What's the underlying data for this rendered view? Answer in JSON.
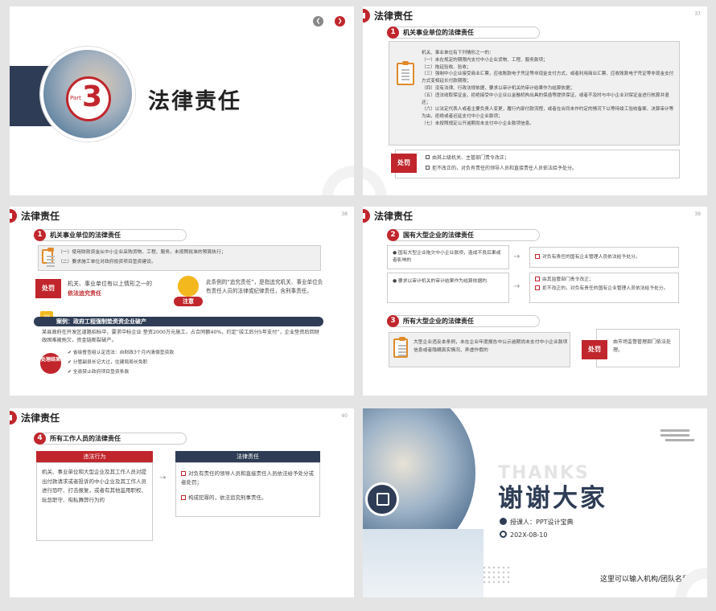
{
  "s1": {
    "part_word": "Part",
    "part_num": "3",
    "title": "法律责任",
    "nav_prev": "❮",
    "nav_next": "❯"
  },
  "s2": {
    "header": "法律责任",
    "page": "37",
    "sec_num": "1",
    "sec_label": "机关事业单位的法律责任",
    "lines": [
      "机关、事业单位有下列情形之一的：",
      "（一）未在规定的期限内支付中小企业货物、工程、服务款项；",
      "（二）拖延验收、验收；",
      "（三）强制中小企业接受商业汇票，应收账款电子凭证等非现金支付方式，或者利用商业汇票、应收账款电子凭证等非现金支付方式变相延长付款期限；",
      "（四）没有法律、行政法规依据，要求以审计机关的审计结果作为结算依据；",
      "（五）违法收取保证金，拒绝接受中小企业以金融机构出具的保函等提供保证，或者不及时与中小企业对保证金进行核算并退还；",
      "（六）以法定代表人或者主要负责人变更，履行内部付款流程，或者在合同未作约定的情况下以等待竣工验收备案、决算审计等为由，拒绝或者迟延支付中小企业款项；",
      "（七）未按照规定公开逾期尚未支付中小企业款项信息。"
    ],
    "tag": "处罚",
    "p1": "由其上级机关、主管部门责令改正；",
    "p2": "拒不改正的，对负有责任的领导人员和直接责任人员依法给予处分。"
  },
  "s3": {
    "header": "法律责任",
    "page": "38",
    "sec_num": "1",
    "sec_label": "机关事业单位的法律责任",
    "l1": "（一）使用财政资金从中小企业采购货物、工程、服务，未按照批准的预算执行；",
    "l2": "（二）要求施工单位对政府投资项目垫资建设。",
    "tag": "处罚",
    "pen_a": "机关、事业单位有以上情形之一的",
    "pen_b": "依法追究责任",
    "note": "注意",
    "note_text": "此条例的“追究责任”，是指追究机关、事业单位负有责任人员的法律或纪律责任，含刑事责任。",
    "case_badge": "案例",
    "case_title": "案例：政府工程强制垫资资企业破产",
    "case_text": "某县政府在开发区道路招标中，要求中标企业 垫资2000万元施工，占合同额40%，约定“竣工后分5年支付”，企业垫资后回财政困难被拖欠，资金链断裂破产。",
    "result": "处理结果",
    "r1": "省级督查组认定违法：自财政3个月内清偿垫资款",
    "r2": "分管副县长记大过，住建局局长免职",
    "r3": "全县禁止政府项目垫资条款"
  },
  "s4": {
    "header": "法律责任",
    "page": "39",
    "sec2_num": "2",
    "sec2_label": "国有大型企业的法律责任",
    "q1": "国有大型企业拖欠中小企业款项，造成不良后果或者影响的",
    "a1": "对负有责任的国有企业管理人员依法给予处分。",
    "q2": "要求以审计机关的审计结果作为结算依据的",
    "a2a": "由其监管部门责令改正；",
    "a2b": "拒不改正的，对负有责任的国有企业管理人员依法给予处分。",
    "sec3_num": "3",
    "sec3_label": "所有大型企业的法律责任",
    "q3": "大型企业违反本条例，未在企业年度报告中公示逾期尚未支付中小企业款项信息或者隐瞒真实情况、弄虚作假的",
    "tag": "处罚",
    "a3": "由市场监督管理部门依法处理。"
  },
  "s5": {
    "header": "法律责任",
    "page": "40",
    "sec_num": "4",
    "sec_label": "所有工作人员的法律责任",
    "h1": "违法行为",
    "h2": "法律责任",
    "left": "机关、事业单位和大型企业及其工作人员对提出付款请求或者投诉的中小企业及其工作人员进行恐吓、打击报复，或者有其他滥用职权、玩忽职守、徇私舞弊行为的",
    "r1": "对负有责任的领导人员和直接责任人员依法给予处分或者处罚；",
    "r2": "构成犯罪的，依法追究刑事责任。"
  },
  "s6": {
    "ghost": "THANKS",
    "title": "谢谢大家",
    "presenter": "授课人：PPT设计宝典",
    "date": "202X-08-10",
    "org": "这里可以输入机构/团队名称"
  },
  "colors": {
    "accent": "#c0262c",
    "dark": "#2e3d55"
  }
}
